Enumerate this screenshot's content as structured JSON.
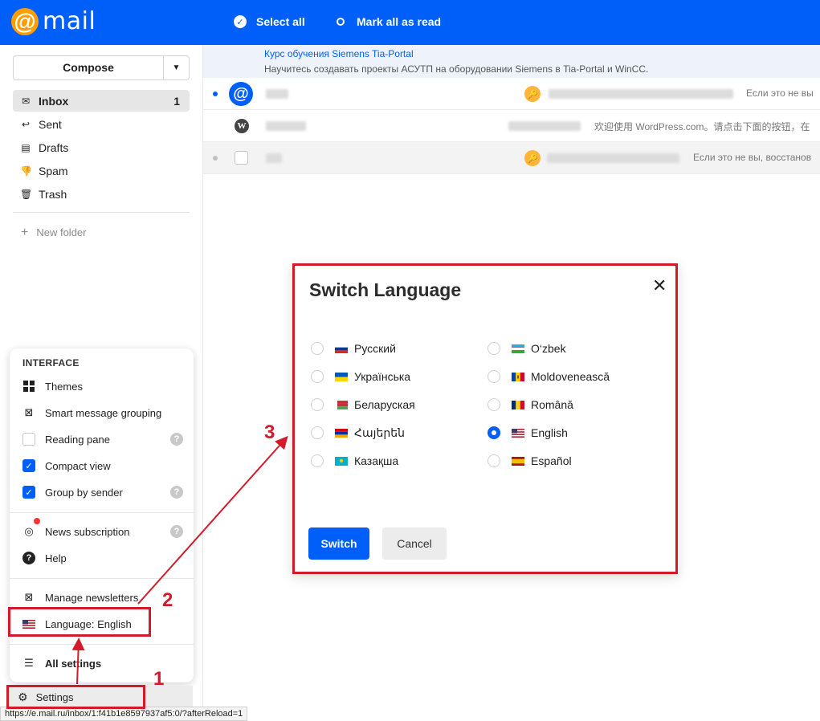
{
  "topbar": {
    "logo_word": "mail",
    "select_all": "Select all",
    "mark_all_read": "Mark all as read"
  },
  "sidebar": {
    "compose": "Compose",
    "folders": [
      {
        "label": "Inbox",
        "count": "1",
        "icon": "inbox-icon"
      },
      {
        "label": "Sent",
        "icon": "sent-icon"
      },
      {
        "label": "Drafts",
        "icon": "drafts-icon"
      },
      {
        "label": "Spam",
        "icon": "spam-icon"
      },
      {
        "label": "Trash",
        "icon": "trash-icon"
      }
    ],
    "new_folder": "New folder"
  },
  "mail_list": {
    "promo_title": "Курс обучения Siemens Tia-Portal",
    "promo_text": "Научитесь создавать проекты АСУТП на оборудовании Siemens в Tia-Portal и WinCC.",
    "rows": [
      {
        "snippet": "Если это не вы"
      },
      {
        "snippet": "欢迎使用 WordPress.com。请点击下面的按钮，在"
      },
      {
        "snippet": "Если это не вы, восстанов"
      }
    ]
  },
  "settings_menu": {
    "header": "INTERFACE",
    "themes": "Themes",
    "smart_grouping": "Smart message grouping",
    "reading_pane": "Reading pane",
    "compact_view": "Compact view",
    "group_by_sender": "Group by sender",
    "news_subscription": "News subscription",
    "help": "Help",
    "manage_newsletters": "Manage newsletters",
    "language": "Language: English",
    "all_settings": "All settings",
    "checks": {
      "reading_pane": false,
      "compact_view": true,
      "group_by_sender": true
    }
  },
  "settings_button": "Settings",
  "status_url": "https://e.mail.ru/inbox/1:f41b1e8597937af5:0/?afterReload=1",
  "dialog": {
    "title": "Switch Language",
    "languages_left": [
      "Русский",
      "Українська",
      "Беларуская",
      "Հայերեն",
      "Казақша"
    ],
    "languages_right": [
      "O‘zbek",
      "Moldovenească",
      "Română",
      "English",
      "Español"
    ],
    "selected": "English",
    "switch_label": "Switch",
    "cancel_label": "Cancel"
  },
  "annotations": {
    "step1": "1",
    "step2": "2",
    "step3": "3"
  },
  "colors": {
    "brand": "#005ff9",
    "annotation": "#d11b2a",
    "logo_orange": "#ff9e00"
  }
}
